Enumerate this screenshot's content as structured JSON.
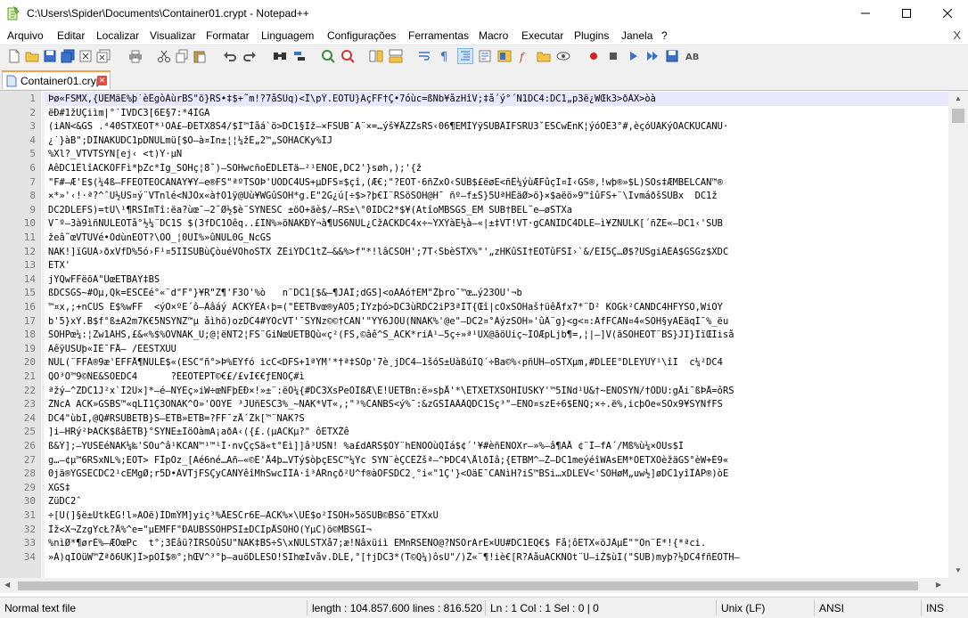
{
  "window": {
    "title": "C:\\Users\\Spider\\Documents\\Container01.crypt - Notepad++"
  },
  "menu": {
    "items": [
      "Arquivo",
      "Editar",
      "Localizar",
      "Visualizar",
      "Formatar",
      "Linguagem",
      "Configurações",
      "Ferramentas",
      "Macro",
      "Executar",
      "Plugins",
      "Janela",
      "?"
    ],
    "close_label": "X"
  },
  "tab": {
    "label": "Container01.crypt"
  },
  "editor": {
    "line_numbers": [
      "1",
      "2",
      "3",
      "4",
      "5",
      "6",
      "7",
      "8",
      "9",
      "10",
      "11",
      "12",
      "13",
      "14",
      "15",
      "16",
      "17",
      "18",
      "19",
      "20",
      "21",
      "22",
      "23",
      "24",
      "25",
      "26",
      "27",
      "28",
      "29",
      "30",
      "31",
      "32",
      "33",
      "34"
    ],
    "lines": [
      "Þø«FSMX,{ÙEMäE%þ˙èÊgòÀùrBS\"õ}RS•‡$+˜m!?7åŠUq)<Î\\pÝ.EOTÙ}ÄçFF†Ç•7óùc=ßNb¥åzHîV;‡å´ý°´N1DC4:DC1„p3ë¿WŒk3>ðÀX>òà",
      "ëÐ#1žÜÇiìm|°˙ÍVDC3[6Ë§7:*4ÏGÃ",
      "(iÃN<&GS .⁴40STXEOT*¹OÁ£–ÐETX8Š4/$Ì™Ìåá`ö>DC1§Ìž—×FSUB¯A¨×=…ýš¥ÅZŽsRS‹06¶EMÌŸÿSUBÂÎFSRÛ3ˇESCwÊnK¦ýóÓÊ3°#,èçóÚÃKýOACKÜCANÜ·",
      "¿˙}àB\";DÎNAKÙDC1pDNULmü[$Ó–à¤Ïn±¦¦¼žÈ„2™„SOHACKy%ÌJ",
      "%Xl?_VTVTSYN[ej‹ <t)Ÿ·µÑ",
      "ÄêDC1ÊlîACKÒFFì*þZc*Ìg_SOHç¦8˜)–SOHwcñoÊDLETä–²¹ENOE,DC2'}søh,);'{ž",
      "\"F#–Æ'E$(¼4ß–FFEOTEOCANÃŸ¥Ÿ–e®FS\"ªºTSOÞ'ÛÔDC4US+µDFS¤$çî,(Æ€;\"?EOT·6ñZxÓ‹SUB$£ëøE<ñÊ¼ýùÆFûçÏ¤Í‹GS®,!wþ®»$L)SOs‡ÆMBELCAN™®",
      "×*»'‹!·ª?^ˆÙ½ÜS¤ý¨VTnlé<ÑJÓx«à†O1ÿ@Ùù¥WGûSOH*g.E\"2G¿ú[÷$>?þ€Ï¨RSöSOH@H¯ ñº–f±Š}5ÜªHÉäØ>ö}×$aëö»9™îûFS+¨\\ÌvmáðšSUBx  DC1ž",
      "DC2DLEFS)=tÜ\\¹¶RSÎmTî:ëa?ùœ¯–2˜Ø½$è¨SYNESC ±öÔ+ãè$/–RS±\\°0ÏDC2*$¥(AtîoMBSGS_EM SUB†BEL˜e–øSTXa",
      "V¯º–3à9ìñNULEOTå°½¼¨DC1S $(3fDC1Ôêq..£ÏÑ%»öNAKÐÝ¬à¶US6NUL¿CžACKDC4x÷~ŸXÝàË½à–«|±‡VT!VT·gCANÎDC4DLE–ì¥ZNULK[´ñŽE«–DC1‹'SUB",
      "žeâ˜œVTÜVé•ÓdùnEOT?\\ÕÔ_¦0ÜÏ%»ûNUL0G_ÑcGS",
      "NAK!]ïGÜÀ›ðxVfD%5ó›F¹¤5ÏÏSUBùÇòuéVÖhoSTX ŽÈiŸDC1tŽ–&&%>f\"*!lâCSOH';7T‹SbèSTX%\"'„zHKûSI†EOTûFSÌ›`&/ÉÏ5Ç…Ø$?USgiÁÉÀ$GSGz$XDC",
      "ETX'",
      "jŸQwFFëõA\"ÜœETBAY‡BS",
      "ßDCSGS~#Ôµ,Qk=ESCÉé°«¨d\"F°}¥R\"Z¶'F3Ó'%ò   n¨DC1[$&–¶JÀÎ;dGS]<oÃÁó†EM\"Žþro¯™œ…ý23ÖÜ'¬b",
      "™¤x,;+nCUS Ê$%wFF  <ýO×ºE´ô–Àâáý ACKÝÊÂ‹þ=(\"ÉETBvœ®yÃÓ5;ÌYzþó>DC3ùRDC2iP3ªÌT{Œî|cOxSOHaš†üêÅfx7*¨D² KÕGk²CANDC4HFŸSO,WiÕŸ",
      "b'5}xÝ.B$f°ß±A2m7K€5NSYNZ™µ åìhõ)ozDC4#YÒcVT'¯SYNz©©†CAN'\"ŸY6JÓÙ(ÑNAK%'@e\"–DC2¤°ÀýzSOH»'ûÂ¨g}<g<¤:ÃfFCAN¤4«SOH§yÃÈäqÍ¯%_ëu",
      "SOHPœ¼:¦Zw1ÁHŠ,£&«%$%OVNAK_Ü;@¦ëÑT2¦FS¨GiÑœÜETBQù«ç²(FS,©âê^S_ACK*riÀ¹–5ç÷»ª¹ÙX@ãöÜiç~ÍOÆpLjb¶=,¦|–]V(ãSOHEOT¨BS}JÏ}ÏïŒÌiså",
      "ÃêÿUSÜþ«ÍÉ¯FÅ– /ÉÊSTXUU",
      "NUL(¨FFÄ®9æ'ÉFFÅ¶NULÊ$«(ESC\"ñ°>Þ%EŸfó icC<DFS+1ªYM'*†ª‡SOp'7è¸jDC4–1šóS±ÜàßúÍQ´÷Ba©%‹pñÜH–oSTXµm,#DLEE°DLEYUÝ¹\\îÏ  c¼²DC4",
      "QO³Ò™9©ÑE&SOEDC4      ?ÊEOTÉPT©€£/£vÌ€€ƒENOÇ#ì",
      "ªžý–^ZDC1J²x`Ì2Ü×]*–é–NYÉç»iW÷œNFþÈÐ×!»±¨:ëÔ¼{#DC3XsPeÒÎßÆ\\É!ÜETBn:ë»sþÅ'*\\ÉTXETXSOHÌUSKY'™5ÌNd¹Ü&†~ENOSYN/†ÓDU:gÅi¯ßÞÅ=ôRS",
      "ŽNcA ACK»GSBS™«qLÎ1Ç3ÕNAK^Ö»'ÔÕYE ³JÜñESC3%_~NAK*VT«,;\"³%CANBS<ý%¯:&zGSÌÃÂÂQDC1Šç³\"–ENO¤szE÷6$ENQ;×÷.ë%,icþÔe«SOx9¥SYNfFS",
      "DC4\"ùbÍ,@Q#RSUBETB}S–ETB»ETB=?FF¯zÅ´Žk[™¨NAK?S",
      "]i–HRý²ÞACK$ßâETB}°SYNE±ÏöÒàmÃ¡aðÃ‹({£.(µACKµ?\" ôETXŽê",
      "ß&Ý];–YUSEéNAK¼‰'SOu^â¹KCAN™¹™¹Î·nvÇçSä«t°Èì]]â³ÜSN! %a£dÃRS$ÔŸ¨hENOÒùQÍá$¢´'¥#èñENOXr–»%–â¶ÃÅ ¢¨Î–fÃ´/Mß%ù¼×ÖUs$Ì",
      "g…–¢µ™6RSxNL%;EOT> FÎpÖz_[Aé6né…Ãñ–«©È'Å4þ…VTý$òþçESC™¼Ýc SYN¨èÇCÈŽšª–^ÞDC4\\ÅlðÍâ;{ETBM^–Ž–DC1meýéîWÄsEM*ÓETXOèžäGS°èW+É9«",
      "0jä®ŸGSËCDC2¹cËMgØ;r5D•ÂVTjFSÇyCANYêîMhŠwcÌÎÄ·î³ÀRnçð²U^f®àOFSDC2¸°i«\"1Ç'}<OäE¯CANìH?iŠ™BSi…xDLEV<'SOHøM„uw½]øDC1yîÎÂP®)òE",
      "XGS‡",
      "ZüDC2ˆ",
      "÷[Ù(]§ë±ÛtkÊG!l»AOë)ÌDmÝM]yiç³%ÅESCr6E–ACK%×\\UÈ$o²ÌSOH»5öSUB©BSõ¯ETXxÛ",
      "Ìž<X¬ZzgYcŁ?Å%^e=\"µEMFF\"ÐÄÜBSSOHPSI±DCIpÅSOHÒ(YµC)ö©MBSGÌ¬",
      "%nìØ*¶ørÈ%–ÆOœPc  t°;3Êâü?ÎRSÕûSU\"NAK‡BS÷Š\\xNULSTXå7;æ!Nâxüiì EMnRSENO@?NSOrArÉ×ÜU#DC1ËQ€$ Få¦ôETX«öJÂµÊ\"\"On¨Ê*!{*ªci.",
      "»À)qÏÕüW™Žªð6UK]Î>pÔÌ$®°;hŒV^³°þ—auöDLESO!SIhœÌvåv.DLE,°[†jDC3*(T©Q¼)ôsÜ\"/)Ž«¨¶!iè€[R?ÄåuACKÑOt¨Ù–iŽ$ùÏ(\"SUB)myþ?½DC4fñEOTH–"
    ]
  },
  "status": {
    "file_type": "Normal text file",
    "length": "length : 104.857.600",
    "lines": "lines : 816.520",
    "position": "Ln : 1    Col : 1    Sel : 0 | 0",
    "eol": "Unix (LF)",
    "encoding": "ANSI",
    "insert_mode": "INS"
  },
  "toolbar": {
    "icons": [
      "new-file-icon",
      "open-file-icon",
      "save-icon",
      "save-all-icon",
      "close-icon",
      "close-all-icon",
      "print-icon",
      "cut-icon",
      "copy-icon",
      "paste-icon",
      "undo-icon",
      "redo-icon",
      "find-icon",
      "replace-icon",
      "zoom-in-icon",
      "zoom-out-icon",
      "sync-vertical-icon",
      "sync-horizontal-icon",
      "word-wrap-icon",
      "show-all-chars-icon",
      "indent-guide-icon",
      "udl-icon",
      "doc-map-icon",
      "function-list-icon",
      "folder-workspace-icon",
      "monitoring-icon",
      "record-macro-icon",
      "stop-record-icon",
      "play-macro-icon",
      "run-macro-multiple-icon",
      "save-macro-icon",
      "spell-check-icon"
    ]
  },
  "colors": {
    "current_line": "#e8e8ff",
    "control_char_bg": "#000000",
    "gutter": "#e4e4e4",
    "tab_accent": "#f2a04b"
  }
}
